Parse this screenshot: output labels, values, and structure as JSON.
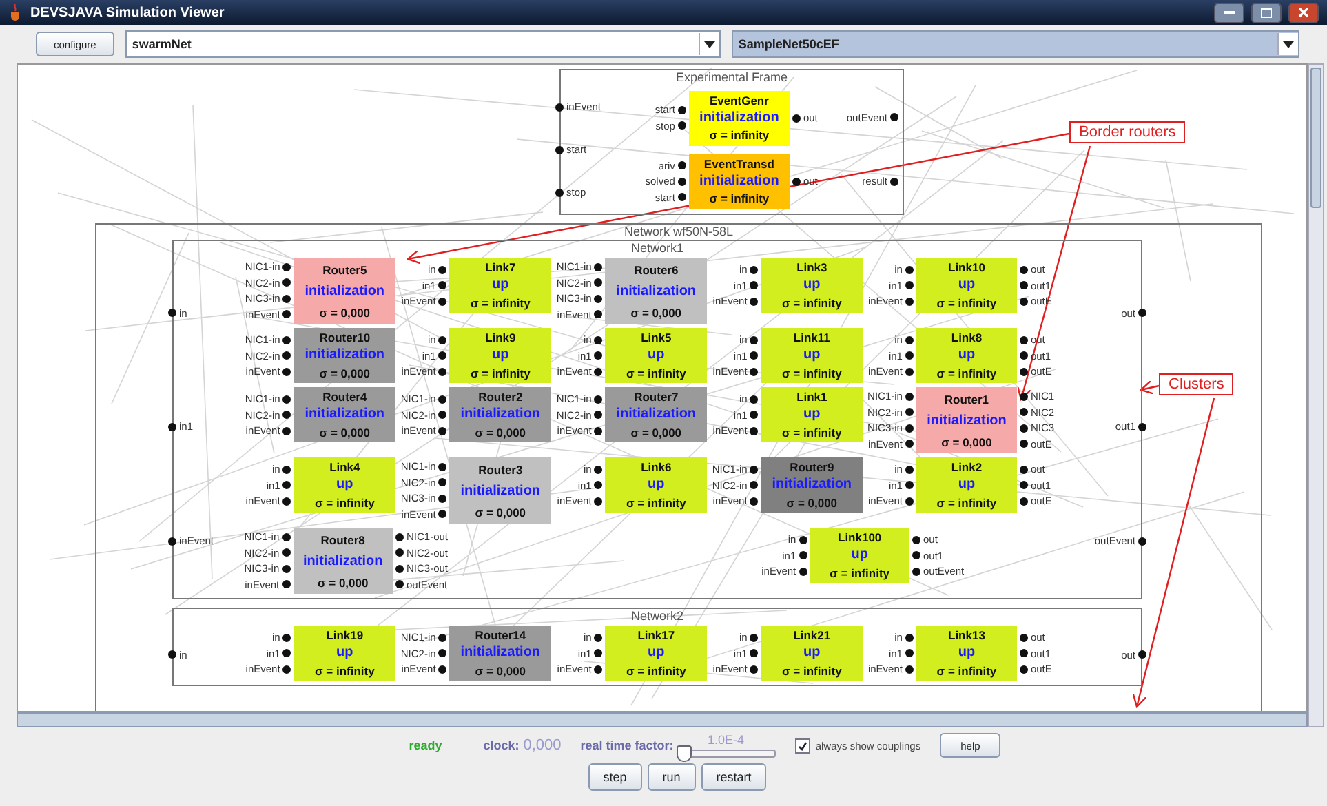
{
  "window": {
    "title": "DEVSJAVA Simulation Viewer"
  },
  "toolbar": {
    "configure_button": "configure",
    "model_select": "swarmNet",
    "instance_select": "SampleNet50cEF"
  },
  "experimental_frame": {
    "title": "Experimental Frame",
    "inputs": [
      "inEvent",
      "start",
      "stop"
    ],
    "outputs": [
      "outEvent",
      "result"
    ],
    "components": [
      {
        "name": "EventGenr",
        "phase": "initialization",
        "sigma": "σ = infinity",
        "color": "#ffff00",
        "inputs": [
          "start",
          "stop"
        ],
        "outputs": [
          "out"
        ]
      },
      {
        "name": "EventTransd",
        "phase": "initialization",
        "sigma": "σ = infinity",
        "color": "#ffc000",
        "inputs": [
          "ariv",
          "solved",
          "start"
        ],
        "outputs": [
          "out"
        ]
      }
    ]
  },
  "network": {
    "title": "Network wf50N-58L",
    "clusters": [
      {
        "title": "Network1",
        "inputs": [
          "in",
          "in1",
          "inEvent"
        ],
        "outputs": [
          "out",
          "out1",
          "outEvent"
        ],
        "rows": [
          [
            {
              "name": "Router5",
              "phase": "initialization",
              "sigma": "σ = 0,000",
              "color": "#f6a9a9",
              "inputs": [
                "NIC1-in",
                "NIC2-in",
                "NIC3-in",
                "inEvent"
              ]
            },
            {
              "name": "Link7",
              "phase": "up",
              "sigma": "σ = infinity",
              "color": "#d2ee1e",
              "inputs": [
                "in",
                "in1",
                "inEvent"
              ]
            },
            {
              "name": "Router6",
              "phase": "initialization",
              "sigma": "σ = 0,000",
              "color": "#c0c0c0",
              "inputs": [
                "NIC1-in",
                "NIC2-in",
                "NIC3-in",
                "inEvent"
              ]
            },
            {
              "name": "Link3",
              "phase": "up",
              "sigma": "σ = infinity",
              "color": "#d2ee1e",
              "inputs": [
                "in",
                "in1",
                "inEvent"
              ]
            },
            {
              "name": "Link10",
              "phase": "up",
              "sigma": "σ = infinity",
              "color": "#d2ee1e",
              "inputs": [
                "in",
                "in1",
                "inEvent"
              ],
              "outputs": [
                "out",
                "out1",
                "outE"
              ]
            }
          ],
          [
            {
              "name": "Router10",
              "phase": "initialization",
              "sigma": "σ = 0,000",
              "color": "#9a9a9a",
              "inputs": [
                "NIC1-in",
                "NIC2-in",
                "inEvent"
              ]
            },
            {
              "name": "Link9",
              "phase": "up",
              "sigma": "σ = infinity",
              "color": "#d2ee1e",
              "inputs": [
                "in",
                "in1",
                "inEvent"
              ]
            },
            {
              "name": "Link5",
              "phase": "up",
              "sigma": "σ = infinity",
              "color": "#d2ee1e",
              "inputs": [
                "in",
                "in1",
                "inEvent"
              ]
            },
            {
              "name": "Link11",
              "phase": "up",
              "sigma": "σ = infinity",
              "color": "#d2ee1e",
              "inputs": [
                "in",
                "in1",
                "inEvent"
              ]
            },
            {
              "name": "Link8",
              "phase": "up",
              "sigma": "σ = infinity",
              "color": "#d2ee1e",
              "inputs": [
                "in",
                "in1",
                "inEvent"
              ],
              "outputs": [
                "out",
                "out1",
                "outE"
              ]
            }
          ],
          [
            {
              "name": "Router4",
              "phase": "initialization",
              "sigma": "σ = 0,000",
              "color": "#9a9a9a",
              "inputs": [
                "NIC1-in",
                "NIC2-in",
                "inEvent"
              ]
            },
            {
              "name": "Router2",
              "phase": "initialization",
              "sigma": "σ = 0,000",
              "color": "#9a9a9a",
              "inputs": [
                "NIC1-in",
                "NIC2-in",
                "inEvent"
              ]
            },
            {
              "name": "Router7",
              "phase": "initialization",
              "sigma": "σ = 0,000",
              "color": "#9a9a9a",
              "inputs": [
                "NIC1-in",
                "NIC2-in",
                "inEvent"
              ]
            },
            {
              "name": "Link1",
              "phase": "up",
              "sigma": "σ = infinity",
              "color": "#d2ee1e",
              "inputs": [
                "in",
                "in1",
                "inEvent"
              ]
            },
            {
              "name": "Router1",
              "phase": "initialization",
              "sigma": "σ = 0,000",
              "color": "#f6a9a9",
              "inputs": [
                "NIC1-in",
                "NIC2-in",
                "NIC3-in",
                "inEvent"
              ],
              "outputs": [
                "NIC1",
                "NIC2",
                "NIC3",
                "outE"
              ]
            }
          ],
          [
            {
              "name": "Link4",
              "phase": "up",
              "sigma": "σ = infinity",
              "color": "#d2ee1e",
              "inputs": [
                "in",
                "in1",
                "inEvent"
              ]
            },
            {
              "name": "Router3",
              "phase": "initialization",
              "sigma": "σ = 0,000",
              "color": "#c0c0c0",
              "inputs": [
                "NIC1-in",
                "NIC2-in",
                "NIC3-in",
                "inEvent"
              ]
            },
            {
              "name": "Link6",
              "phase": "up",
              "sigma": "σ = infinity",
              "color": "#d2ee1e",
              "inputs": [
                "in",
                "in1",
                "inEvent"
              ]
            },
            {
              "name": "Router9",
              "phase": "initialization",
              "sigma": "σ = 0,000",
              "color": "#808080",
              "inputs": [
                "NIC1-in",
                "NIC2-in",
                "inEvent"
              ]
            },
            {
              "name": "Link2",
              "phase": "up",
              "sigma": "σ = infinity",
              "color": "#d2ee1e",
              "inputs": [
                "in",
                "in1",
                "inEvent"
              ],
              "outputs": [
                "out",
                "out1",
                "outE"
              ]
            }
          ],
          [
            {
              "name": "Router8",
              "phase": "initialization",
              "sigma": "σ = 0,000",
              "color": "#c0c0c0",
              "inputs": [
                "NIC1-in",
                "NIC2-in",
                "NIC3-in",
                "inEvent"
              ],
              "outputs": [
                "NIC1-out",
                "NIC2-out",
                "NIC3-out",
                "outEvent"
              ]
            },
            null,
            null,
            {
              "name": "Link100",
              "phase": "up",
              "sigma": "σ = infinity",
              "color": "#d2ee1e",
              "inputs": [
                "in",
                "in1",
                "inEvent"
              ],
              "outputs": [
                "out",
                "out1",
                "outEvent"
              ]
            }
          ]
        ]
      },
      {
        "title": "Network2",
        "inputs": [
          "in"
        ],
        "outputs": [
          "out"
        ],
        "rows": [
          [
            {
              "name": "Link19",
              "phase": "up",
              "sigma": "σ = infinity",
              "color": "#d2ee1e",
              "inputs": [
                "in",
                "in1",
                "inEvent"
              ]
            },
            {
              "name": "Router14",
              "phase": "initialization",
              "sigma": "σ = 0,000",
              "color": "#9a9a9a",
              "inputs": [
                "NIC1-in",
                "NIC2-in",
                "inEvent"
              ]
            },
            {
              "name": "Link17",
              "phase": "up",
              "sigma": "σ = infinity",
              "color": "#d2ee1e",
              "inputs": [
                "in",
                "in1",
                "inEvent"
              ]
            },
            {
              "name": "Link21",
              "phase": "up",
              "sigma": "σ = infinity",
              "color": "#d2ee1e",
              "inputs": [
                "in",
                "in1",
                "inEvent"
              ]
            },
            {
              "name": "Link13",
              "phase": "up",
              "sigma": "σ = infinity",
              "color": "#d2ee1e",
              "inputs": [
                "in",
                "in1",
                "inEvent"
              ],
              "outputs": [
                "out",
                "out1",
                "outE"
              ]
            }
          ]
        ]
      }
    ]
  },
  "annotations": [
    {
      "text": "Border routers"
    },
    {
      "text": "Clusters"
    }
  ],
  "controls": {
    "status": "ready",
    "clock_label": "clock:",
    "clock_value": "0,000",
    "speed_label": "real time factor:",
    "speed_value": "1.0E-4",
    "speed": {
      "level": 0.04
    },
    "couplings": {
      "label": "always show couplings",
      "checked": true
    },
    "help_button": "help",
    "buttons": [
      "step",
      "run",
      "restart"
    ]
  }
}
